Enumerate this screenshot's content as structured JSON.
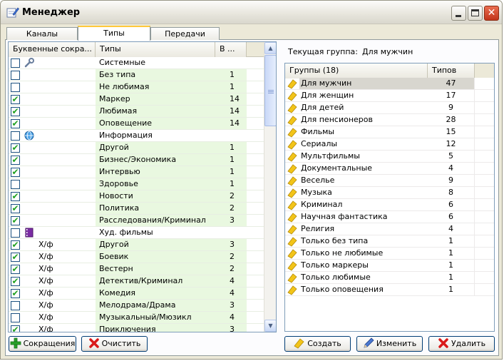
{
  "window": {
    "title": "Менеджер",
    "icons": {
      "app": "notepad-pencil-icon",
      "minimize": "minimize-icon",
      "maximize": "maximize-icon",
      "close": "close-icon"
    }
  },
  "tabs": [
    "Каналы",
    "Типы",
    "Передачи"
  ],
  "active_tab": "Типы",
  "types_table": {
    "columns": [
      "Буквенные сокра...",
      "Типы",
      "В ..."
    ],
    "rows": [
      {
        "checked": false,
        "icon": "wrench-icon",
        "abbr": "",
        "type": "Системные",
        "count": "",
        "green": false
      },
      {
        "checked": false,
        "icon": "",
        "abbr": "",
        "type": "Без типа",
        "count": "1",
        "green": true
      },
      {
        "checked": false,
        "icon": "",
        "abbr": "",
        "type": "Не любимая",
        "count": "1",
        "green": true
      },
      {
        "checked": true,
        "icon": "",
        "abbr": "",
        "type": "Маркер",
        "count": "14",
        "green": true
      },
      {
        "checked": true,
        "icon": "",
        "abbr": "",
        "type": "Любимая",
        "count": "14",
        "green": true
      },
      {
        "checked": true,
        "icon": "",
        "abbr": "",
        "type": "Оповещение",
        "count": "14",
        "green": true
      },
      {
        "checked": false,
        "icon": "globe-icon",
        "abbr": "",
        "type": "Информация",
        "count": "",
        "green": false
      },
      {
        "checked": true,
        "icon": "",
        "abbr": "",
        "type": "Другой",
        "count": "1",
        "green": true
      },
      {
        "checked": true,
        "icon": "",
        "abbr": "",
        "type": "Бизнес/Экономика",
        "count": "1",
        "green": true
      },
      {
        "checked": true,
        "icon": "",
        "abbr": "",
        "type": "Интервью",
        "count": "1",
        "green": true
      },
      {
        "checked": false,
        "icon": "",
        "abbr": "",
        "type": "Здоровье",
        "count": "1",
        "green": true
      },
      {
        "checked": true,
        "icon": "",
        "abbr": "",
        "type": "Новости",
        "count": "2",
        "green": true
      },
      {
        "checked": true,
        "icon": "",
        "abbr": "",
        "type": "Политика",
        "count": "2",
        "green": true
      },
      {
        "checked": true,
        "icon": "",
        "abbr": "",
        "type": "Расследования/Криминал",
        "count": "3",
        "green": true
      },
      {
        "checked": false,
        "icon": "film-icon",
        "abbr": "",
        "type": "Худ. фильмы",
        "count": "",
        "green": false
      },
      {
        "checked": true,
        "icon": "",
        "abbr": "Х/ф",
        "type": "Другой",
        "count": "3",
        "green": true
      },
      {
        "checked": true,
        "icon": "",
        "abbr": "Х/ф",
        "type": "Боевик",
        "count": "2",
        "green": true
      },
      {
        "checked": true,
        "icon": "",
        "abbr": "Х/ф",
        "type": "Вестерн",
        "count": "2",
        "green": true
      },
      {
        "checked": true,
        "icon": "",
        "abbr": "Х/ф",
        "type": "Детектив/Криминал",
        "count": "4",
        "green": true
      },
      {
        "checked": true,
        "icon": "",
        "abbr": "Х/ф",
        "type": "Комедия",
        "count": "4",
        "green": true
      },
      {
        "checked": false,
        "icon": "",
        "abbr": "Х/ф",
        "type": "Мелодрама/Драма",
        "count": "3",
        "green": true
      },
      {
        "checked": false,
        "icon": "",
        "abbr": "Х/ф",
        "type": "Музыкальный/Мюзикл",
        "count": "4",
        "green": true
      },
      {
        "checked": true,
        "icon": "",
        "abbr": "Х/ф",
        "type": "Приключения",
        "count": "3",
        "green": true
      }
    ]
  },
  "left_buttons": {
    "abbreviations": "Сокращения",
    "clear": "Очистить"
  },
  "current_group": {
    "label": "Текущая группа:",
    "value": "Для мужчин"
  },
  "groups_table": {
    "columns": [
      "Группы (18)",
      "Типов"
    ],
    "selected_index": 0,
    "rows": [
      {
        "name": "Для мужчин",
        "count": "47"
      },
      {
        "name": "Для женщин",
        "count": "17"
      },
      {
        "name": "Для детей",
        "count": "9"
      },
      {
        "name": "Для пенсионеров",
        "count": "28"
      },
      {
        "name": "Фильмы",
        "count": "15"
      },
      {
        "name": "Сериалы",
        "count": "12"
      },
      {
        "name": "Мультфильмы",
        "count": "5"
      },
      {
        "name": "Документальные",
        "count": "4"
      },
      {
        "name": "Веселье",
        "count": "9"
      },
      {
        "name": "Музыка",
        "count": "8"
      },
      {
        "name": "Криминал",
        "count": "6"
      },
      {
        "name": "Научная фантастика",
        "count": "6"
      },
      {
        "name": "Религия",
        "count": "4"
      },
      {
        "name": "Только без типа",
        "count": "1"
      },
      {
        "name": "Только не любимые",
        "count": "1"
      },
      {
        "name": "Только маркеры",
        "count": "1"
      },
      {
        "name": "Только любимые",
        "count": "1"
      },
      {
        "name": "Только оповещения",
        "count": "1"
      }
    ]
  },
  "right_buttons": {
    "create": "Создать",
    "edit": "Изменить",
    "delete": "Удалить"
  },
  "colors": {
    "row_green": "#e9f8e0",
    "check_green": "#21a121",
    "tab_accent": "#ffc83c",
    "folder_yellow": "#f2c419"
  }
}
